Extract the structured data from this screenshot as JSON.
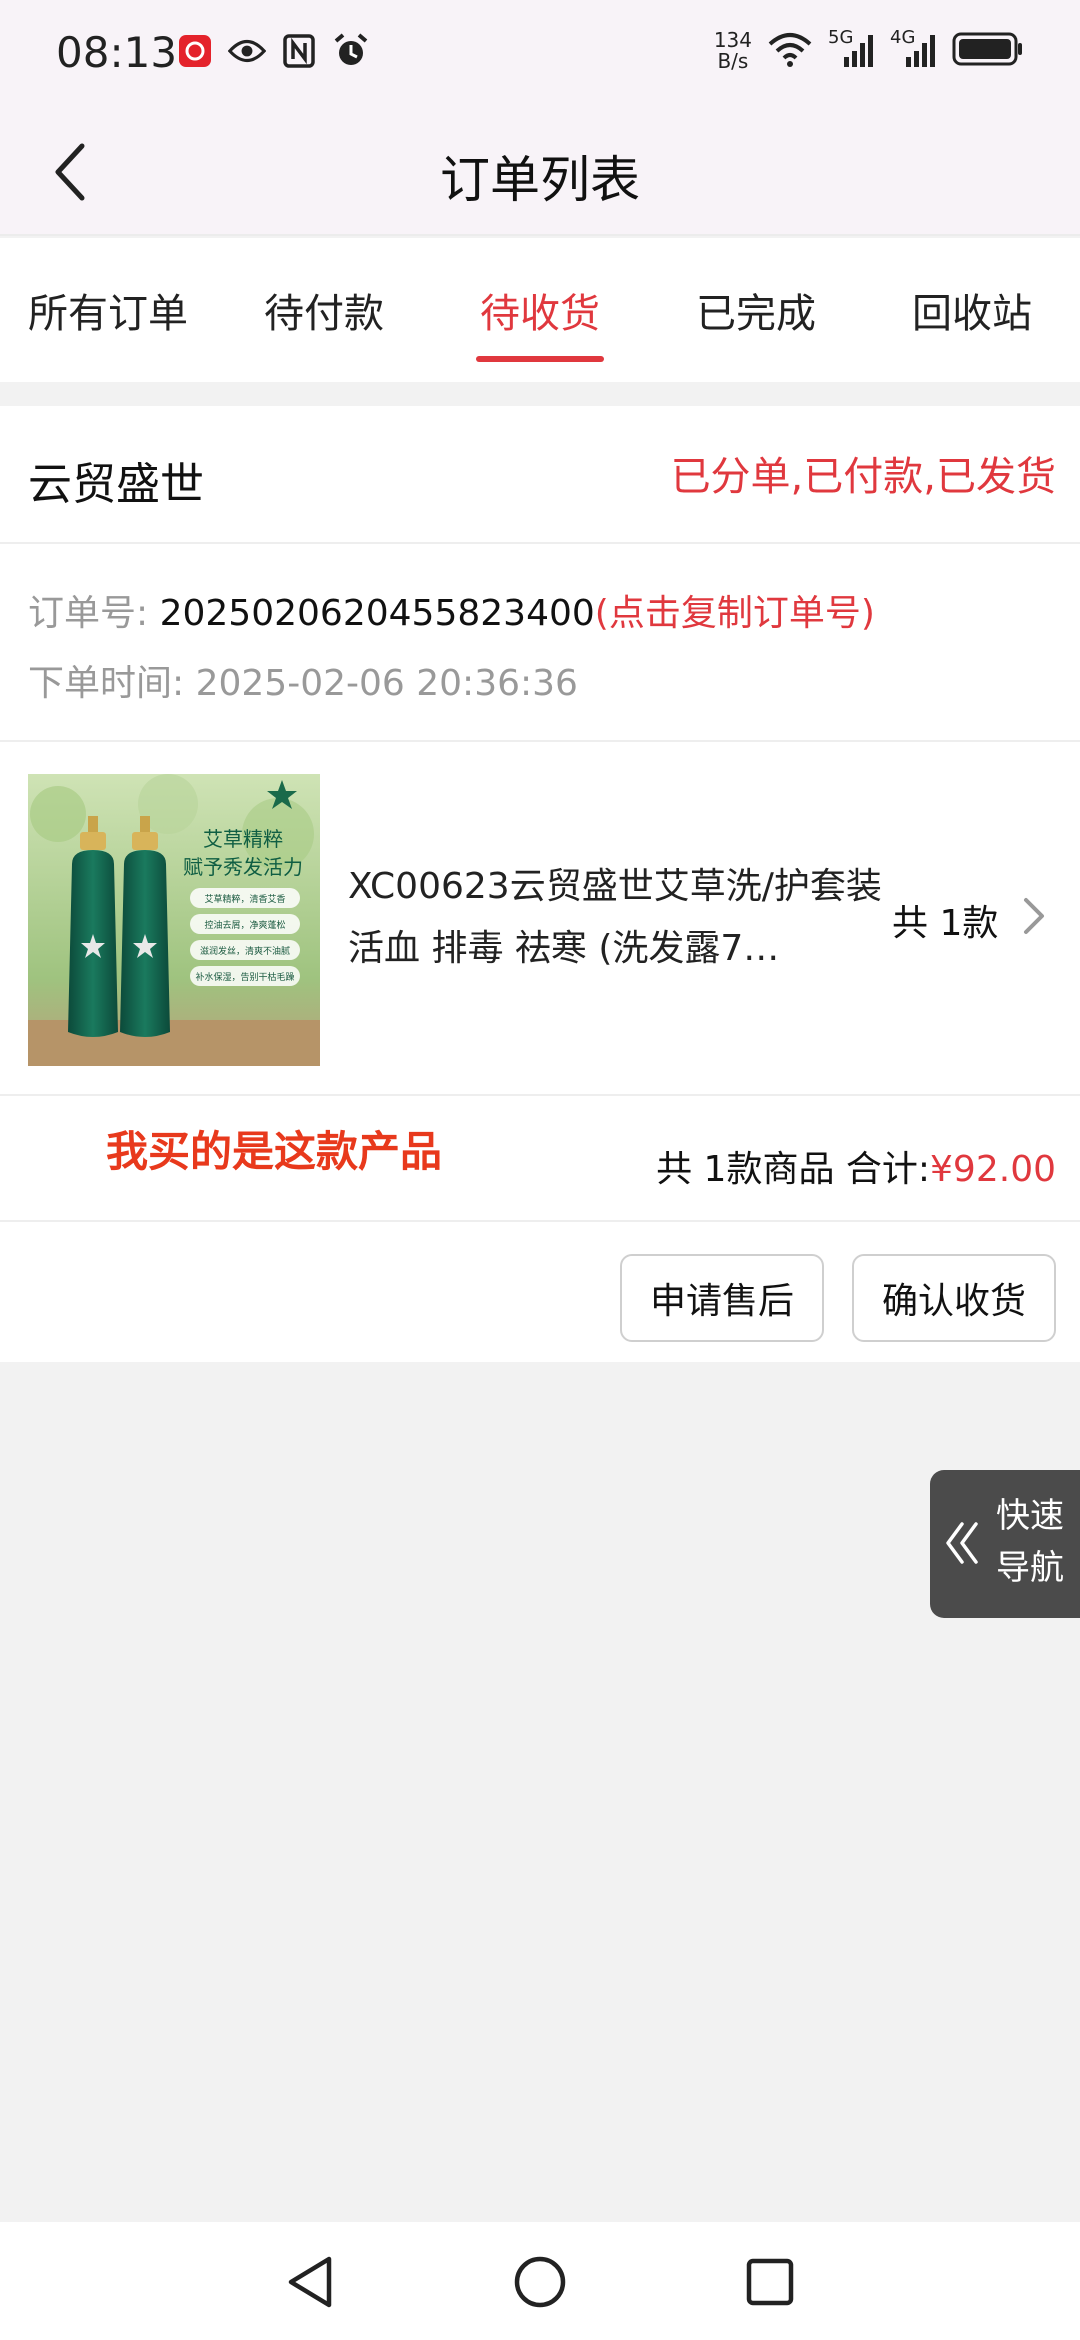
{
  "status_bar": {
    "time": "08:13",
    "net_rate_value": "134",
    "net_rate_unit": "B/s",
    "signal_labels": [
      "5G",
      "4G"
    ],
    "icons": [
      "app-badge-icon",
      "eye-icon",
      "nfc-icon",
      "alarm-icon",
      "wifi-icon",
      "signal-5g-icon",
      "signal-4g-icon",
      "battery-icon"
    ]
  },
  "header": {
    "title": "订单列表",
    "back_icon": "back-arrow-icon"
  },
  "tabs": [
    {
      "label": "所有订单",
      "active": false
    },
    {
      "label": "待付款",
      "active": false
    },
    {
      "label": "待收货",
      "active": true
    },
    {
      "label": "已完成",
      "active": false
    },
    {
      "label": "回收站",
      "active": false
    }
  ],
  "order": {
    "shop_name": "云贸盛世",
    "status": "已分单,已付款,已发货",
    "order_no_label": "订单号:",
    "order_no": "20250206204558234​00",
    "copy_hint": "(点击复制订单号)",
    "time_label": "下单时间:",
    "time": "2025-02-06 20:36:36",
    "product": {
      "title": "XC00623云贸盛世艾草洗/护套装 活血 排毒 祛寒 (洗发露7…",
      "count_text": "共 1款",
      "image_text": {
        "headline1": "艾草精粹",
        "headline2": "赋予秀发活力",
        "bullets": [
          "艾草精粹，清香艾香",
          "控油去屑，净爽蓬松",
          "滋润发丝，清爽不油腻",
          "补水保湿，告别干枯毛躁"
        ]
      }
    },
    "annotation": "我买的是这款产品",
    "total_prefix": "共 1款商品 合计:",
    "total_price": "¥92.00",
    "buttons": {
      "after_sale": "申请售后",
      "confirm": "确认收货"
    }
  },
  "quick_nav": {
    "line1": "快速",
    "line2": "导航"
  },
  "colors": {
    "accent": "#e0383e",
    "annotation": "#e8391c",
    "header_bg": "#f8f3f8",
    "page_bg": "#f2f2f2",
    "floater_bg": "#4b4b4b"
  }
}
